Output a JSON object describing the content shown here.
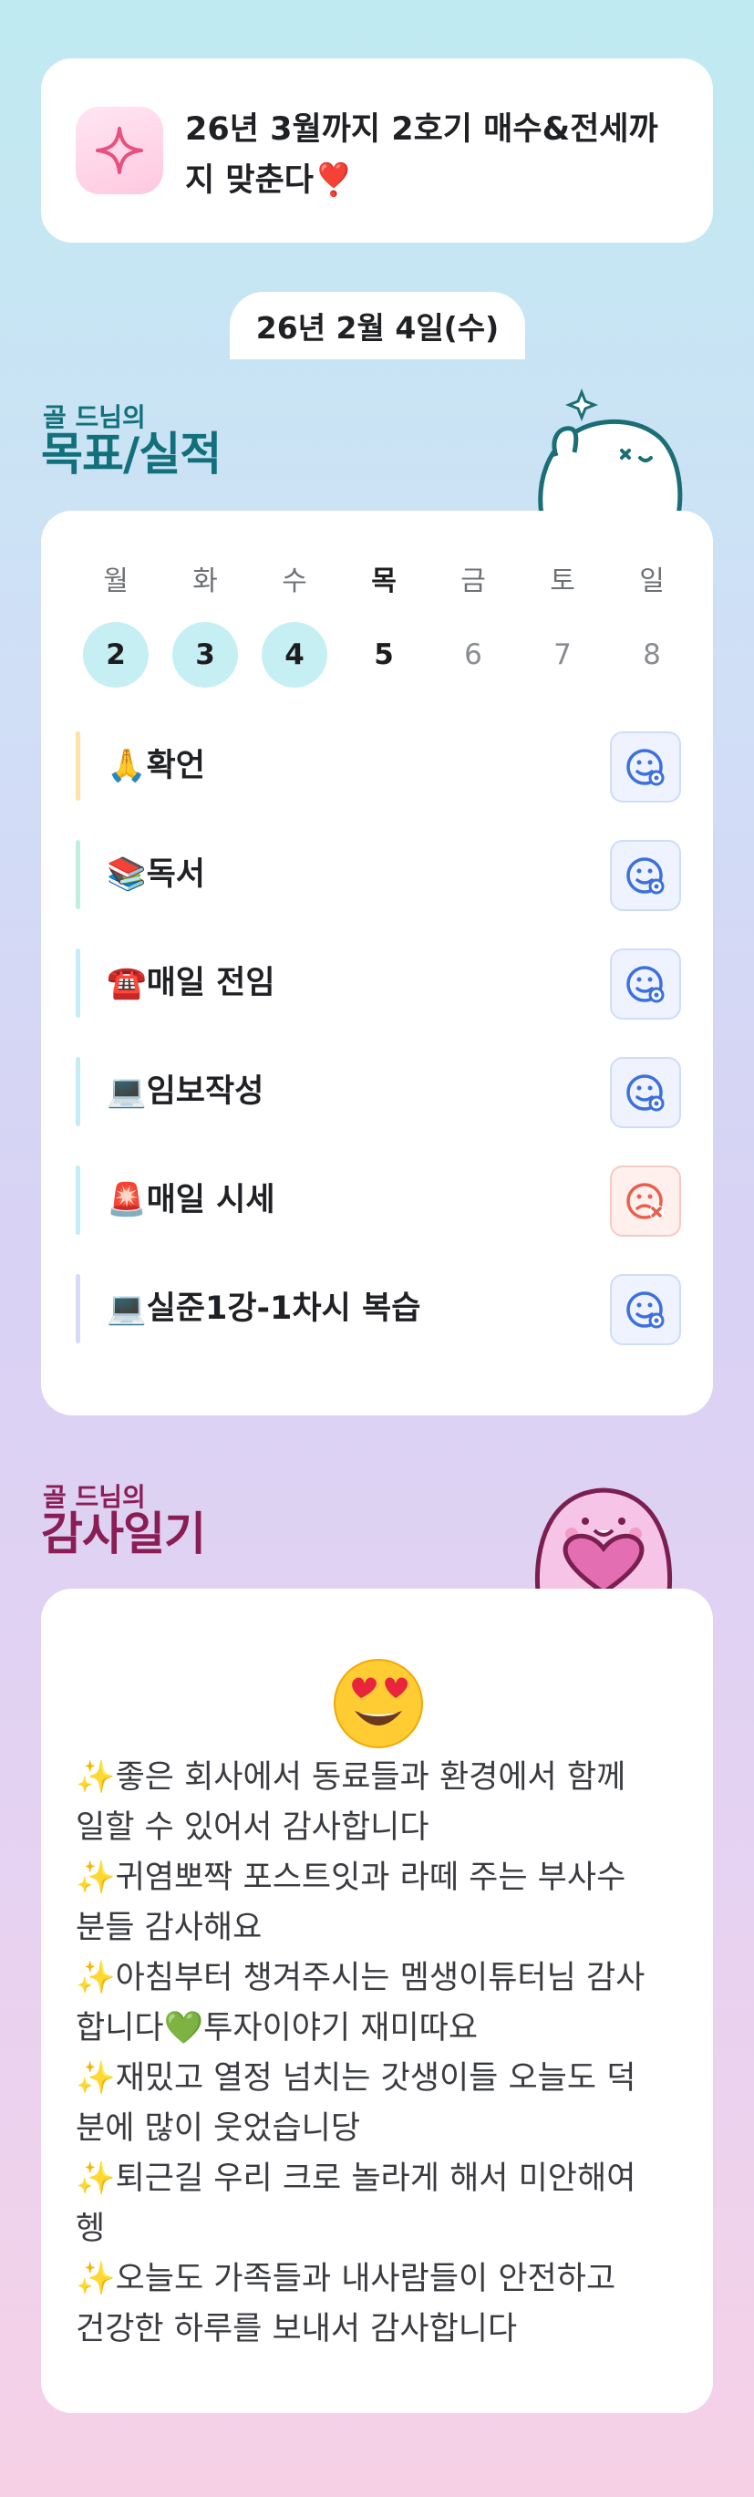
{
  "goal_banner": {
    "icon": "sparkle-icon",
    "text": "26년 3월까지 2호기 매수&전세까지 맞춘다❣️"
  },
  "date_label": "26년 2월 4일(수)",
  "goals_section": {
    "subtitle": "골 드님의",
    "title": "목표/실적",
    "week": [
      {
        "day": "월",
        "date": "2",
        "state": "done"
      },
      {
        "day": "화",
        "date": "3",
        "state": "done"
      },
      {
        "day": "수",
        "date": "4",
        "state": "done"
      },
      {
        "day": "목",
        "date": "5",
        "state": "today"
      },
      {
        "day": "금",
        "date": "6",
        "state": "future"
      },
      {
        "day": "토",
        "date": "7",
        "state": "future"
      },
      {
        "day": "일",
        "date": "8",
        "state": "future"
      }
    ],
    "items": [
      {
        "label": "🙏확언",
        "status": "done",
        "bar_color": "#ffe2a6"
      },
      {
        "label": "📚독서",
        "status": "done",
        "bar_color": "#bff0df"
      },
      {
        "label": "☎️매일 전임",
        "status": "done",
        "bar_color": "#c4ecf6"
      },
      {
        "label": "💻임보작성",
        "status": "done",
        "bar_color": "#c4ecf6"
      },
      {
        "label": "🚨매일 시세",
        "status": "missed",
        "bar_color": "#c4ecf6"
      },
      {
        "label": "💻실준1강-1차시 복습",
        "status": "done",
        "bar_color": "#d6dcf8"
      }
    ]
  },
  "gratitude_section": {
    "subtitle": "골 드님의",
    "title": "감사일기",
    "emoji": "heart-eyes-emoji",
    "lines": [
      "✨좋은 회사에서 동료들과 환경에서 함께",
      "일할 수 있어서 감사합니다",
      "✨귀염뽀짝 포스트잇과 라떼 주는 부사수",
      "분들 감사해요",
      "✨아침부터 챙겨주시는 멤생이튜터님 감사",
      "합니다💚투자이야기 재미따요",
      "✨재밌고 열정 넘치는 갓생이들 오늘도 덕",
      "분에 많이 웃었습니당",
      "✨퇴근길 우리 크로 놀라게 해서 미안해여",
      "헹",
      "✨오늘도 가족들과 내사람들이 안전하고",
      "건강한 하루를 보내서 감사합니다"
    ]
  },
  "colors": {
    "teal": "#12707a",
    "plum": "#8a1d55",
    "done_circle": "#c6eff3",
    "status_ok": "#3c6fe0",
    "status_miss": "#e8604c"
  }
}
